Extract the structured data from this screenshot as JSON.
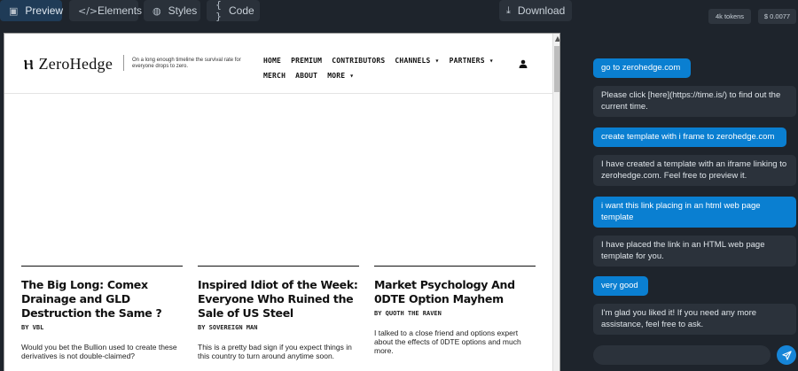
{
  "toolbar": {
    "tabs": [
      {
        "label": "Preview",
        "icon": "image-icon"
      },
      {
        "label": "Elements",
        "icon": "code-icon"
      },
      {
        "label": "Styles",
        "icon": "palette-icon"
      },
      {
        "label": "Code",
        "icon": "braces-icon"
      }
    ],
    "download_label": "Download"
  },
  "site": {
    "logo_text": "ZeroHedge",
    "tagline": "On a long enough timeline the survival rate for everyone drops to zero.",
    "nav_row1": [
      "HOME",
      "PREMIUM",
      "CONTRIBUTORS",
      "CHANNELS ▾",
      "PARTNERS ▾"
    ],
    "nav_row2": [
      "MERCH",
      "ABOUT",
      "MORE ▾"
    ],
    "articles": [
      {
        "title": "The Big Long: Comex Drainage and GLD Destruction the Same ?",
        "byline": "BY VBL",
        "excerpt": "Would you bet the Bullion used to create these derivatives is not double-claimed?"
      },
      {
        "title": "Inspired Idiot of the Week: Everyone Who Ruined the Sale of US Steel",
        "byline": "BY SOVEREIGN MAN",
        "excerpt": "This is a pretty bad sign if you expect things in this country to turn around anytime soon."
      },
      {
        "title": "Market Psychology And 0DTE Option Mayhem",
        "byline": "BY QUOTH THE RAVEN",
        "excerpt": "I talked to a close friend and options expert about the effects of 0DTE options and much more."
      }
    ]
  },
  "chat": {
    "tokens": "4k tokens",
    "cost": "$ 0.0077",
    "messages": [
      {
        "role": "user",
        "text": "go to zerohedge.com"
      },
      {
        "role": "bot",
        "text": "Please click [here](https://time.is/) to find out the current time."
      },
      {
        "role": "user",
        "text": "create template with i frame to zerohedge.com"
      },
      {
        "role": "bot",
        "text": "I have created a template with an iframe linking to zerohedge.com. Feel free to preview it."
      },
      {
        "role": "user",
        "text": "i want this link placing in an html web page template"
      },
      {
        "role": "bot",
        "text": "I have placed the link in an HTML web page template for you."
      },
      {
        "role": "user",
        "text": "very good"
      },
      {
        "role": "bot",
        "text": "I'm glad you liked it! If you need any more assistance, feel free to ask."
      }
    ],
    "input_placeholder": ""
  }
}
